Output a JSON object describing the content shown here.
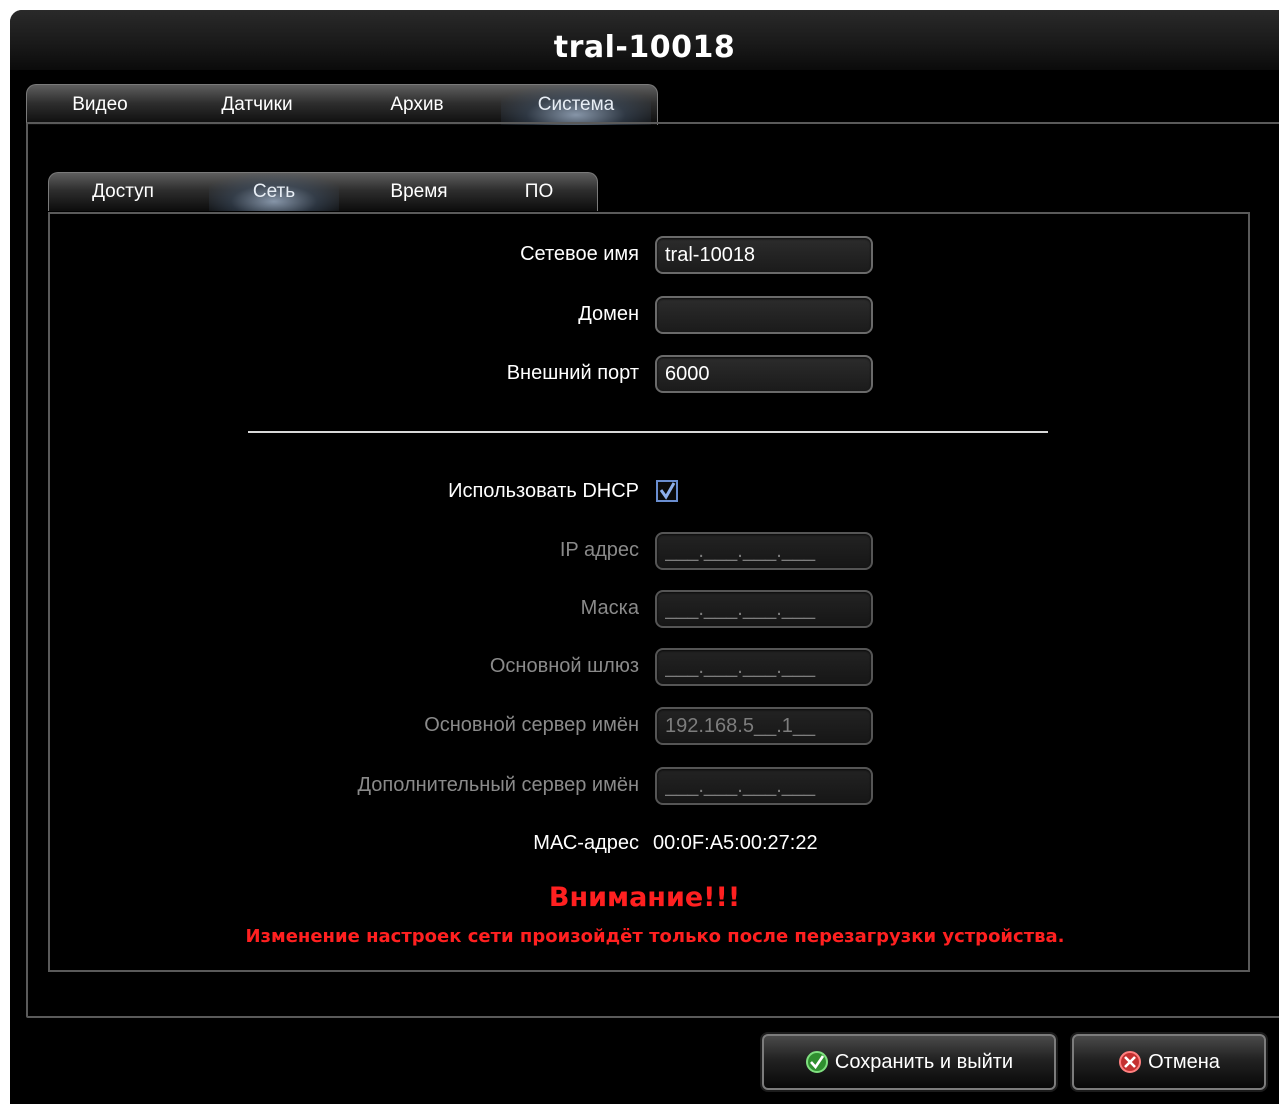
{
  "window": {
    "title": "tral-10018"
  },
  "main_tabs": [
    {
      "label": "Видео"
    },
    {
      "label": "Датчики"
    },
    {
      "label": "Архив"
    },
    {
      "label": "Система",
      "active": true
    }
  ],
  "sub_tabs": [
    {
      "label": "Доступ"
    },
    {
      "label": "Сеть",
      "active": true
    },
    {
      "label": "Время"
    },
    {
      "label": "ПО"
    }
  ],
  "network": {
    "hostname": {
      "label": "Сетевое имя",
      "value": "tral-10018"
    },
    "domain": {
      "label": "Домен",
      "value": ""
    },
    "external_port": {
      "label": "Внешний порт",
      "value": "6000"
    },
    "dhcp": {
      "label": "Использовать DHCP",
      "checked": true
    },
    "ip_address": {
      "label": "IP адрес",
      "value": "___.___.___.___"
    },
    "mask": {
      "label": "Маска",
      "value": "___.___.___.___"
    },
    "gateway": {
      "label": "Основной шлюз",
      "value": "___.___.___.___"
    },
    "primary_dns": {
      "label": "Основной сервер имён",
      "value": "192.168.5__.1__"
    },
    "secondary_dns": {
      "label": "Дополнительный сервер имён",
      "value": "___.___.___.___"
    },
    "mac": {
      "label": "МАС-адрес",
      "value": "00:0F:A5:00:27:22"
    }
  },
  "warning": {
    "title": "Внимание!!!",
    "text": "Изменение настроек сети произойдёт только после перезагрузки устройства."
  },
  "buttons": {
    "save_label": "Сохранить и выйти",
    "cancel_label": "Отмена"
  },
  "colors": {
    "background": "#000000",
    "warning": "#ff2020",
    "checkbox_check": "#6a8ed0",
    "save_icon": "#3fbf3f",
    "cancel_icon": "#e04040"
  }
}
